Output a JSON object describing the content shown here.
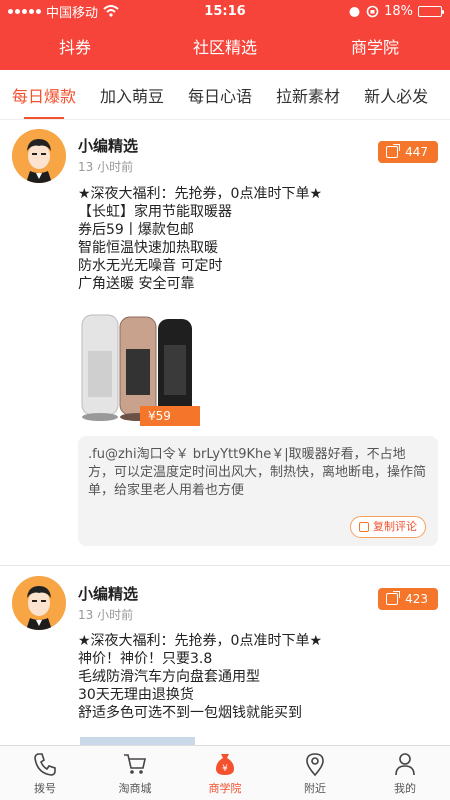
{
  "status_bar": {
    "carrier": "中国移动",
    "time": "15:16",
    "battery": "18%",
    "battery_level": 0.18
  },
  "top_nav": [
    "抖券",
    "社区精选",
    "商学院"
  ],
  "sub_tabs": [
    "每日爆款",
    "加入萌豆",
    "每日心语",
    "拉新素材",
    "新人必发"
  ],
  "active_sub_tab": "每日爆款",
  "posts": [
    {
      "name": "小编精选",
      "time": "13 小时前",
      "share_count": "447",
      "lines": [
        "★深夜大福利：先抢券，0点准时下单★",
        "【长虹】家用节能取暖器",
        "券后59丨爆款包邮",
        "智能恒温快速加热取暖",
        "防水无光无噪音 可定时",
        "广角送暖 安全可靠"
      ],
      "price": "¥59",
      "comment": ".fu@zhi淘口令￥ brLyYtt9Khe￥|取暖器好看，不占地方，可以定温度定时间出风大，制热快，离地断电，操作简单，给家里老人用着也方便",
      "copy_label": "复制评论"
    },
    {
      "name": "小编精选",
      "time": "13 小时前",
      "share_count": "423",
      "lines": [
        "★深夜大福利：先抢券，0点准时下单★",
        "神价！神价！只要3.8",
        "毛绒防滑汽车方向盘套通用型",
        "30天无理由退换货",
        "舒适多色可选不到一包烟钱就能买到"
      ]
    }
  ],
  "tab_bar": [
    {
      "label": "拨号",
      "icon": "phone-icon"
    },
    {
      "label": "淘商城",
      "icon": "cart-icon"
    },
    {
      "label": "商学院",
      "icon": "money-bag-icon"
    },
    {
      "label": "附近",
      "icon": "location-pin-icon"
    },
    {
      "label": "我的",
      "icon": "person-icon"
    }
  ],
  "active_tab": "商学院",
  "colors": {
    "header": "#f6443a",
    "accent": "#f4512f",
    "badge": "#f5762a"
  }
}
